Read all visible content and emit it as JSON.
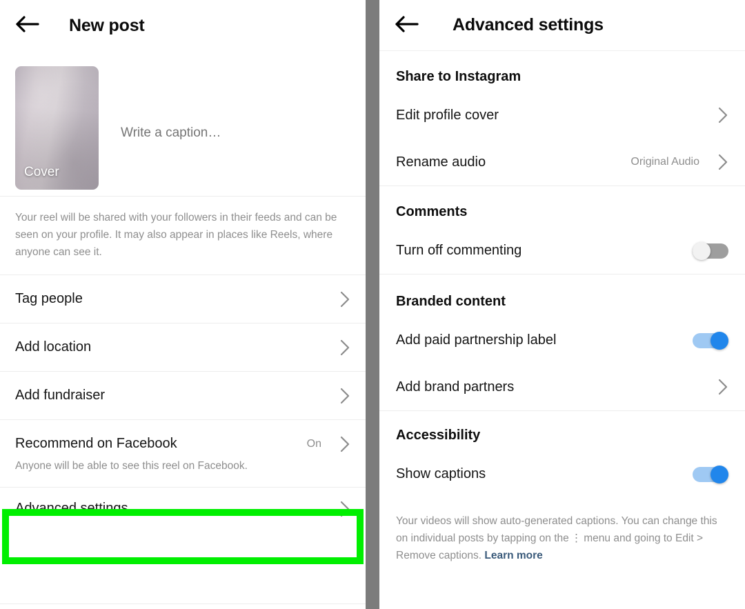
{
  "left_panel": {
    "header": {
      "title": "New post",
      "back_icon": "back-arrow-icon"
    },
    "compose": {
      "cover_label": "Cover",
      "caption_placeholder": "Write a caption…"
    },
    "share_note": "Your reel will be shared with your followers in their feeds and can be seen on your profile. It may also appear in places like Reels, where anyone can see it.",
    "rows": [
      {
        "label": "Tag people",
        "value": "",
        "chevron": "chevron-right-icon"
      },
      {
        "label": "Add location",
        "value": "",
        "chevron": "chevron-right-icon"
      },
      {
        "label": "Add fundraiser",
        "value": "",
        "chevron": "chevron-right-icon"
      },
      {
        "label": "Recommend on Facebook",
        "value": "On",
        "chevron": "chevron-right-icon"
      }
    ],
    "facebook_note": "Anyone will be able to see this reel on Facebook.",
    "advanced_row": {
      "label": "Advanced settings",
      "chevron": "chevron-right-icon"
    }
  },
  "right_panel": {
    "header": {
      "title": "Advanced settings",
      "back_icon": "back-arrow-icon"
    },
    "sections": {
      "share": {
        "title": "Share to Instagram",
        "rows": [
          {
            "label": "Edit profile cover",
            "value": "",
            "chevron": "chevron-right-icon"
          },
          {
            "label": "Rename audio",
            "value": "Original Audio",
            "chevron": "chevron-right-icon"
          }
        ]
      },
      "comments": {
        "title": "Comments",
        "toggle_label": "Turn off commenting",
        "toggle_state": "off"
      },
      "branded": {
        "title": "Branded content",
        "paid_label": "Add paid partnership label",
        "paid_toggle_state": "on",
        "partners_label": "Add brand partners",
        "partners_chevron": "chevron-right-icon"
      },
      "accessibility": {
        "title": "Accessibility",
        "captions_label": "Show captions",
        "captions_toggle_state": "on",
        "note_part1": "Your videos will show auto-generated captions. You can change this on individual posts by tapping on the",
        "note_kebab": "⋮",
        "note_part2": "menu and going to Edit > Remove captions.",
        "learn_more": "Learn more"
      }
    }
  },
  "annotations": {
    "highlight_color": "#00ef00",
    "highlight_advanced_settings": "Advanced settings",
    "highlight_branded_content": "Branded content"
  },
  "colors": {
    "accent_blue": "#2186eb",
    "track_blue": "#9fc9f3",
    "toggle_off_gray": "#9e9e9e",
    "divider_gray": "#7c7c7c",
    "muted_text": "#8e8e8e",
    "link_text": "#3a5a7a"
  }
}
